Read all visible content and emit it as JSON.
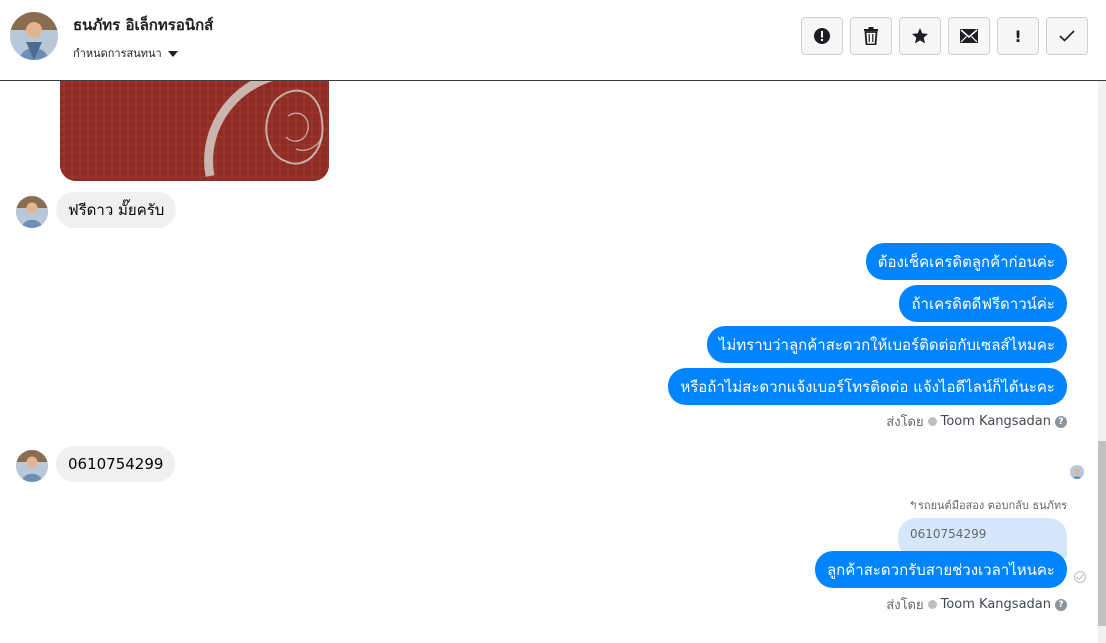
{
  "header": {
    "name": "ธนภัทร อิเล็กทรอนิกส์",
    "subtitle": "กำหนดการสนทนา"
  },
  "actions": [
    {
      "icon": "alert-circle-icon"
    },
    {
      "icon": "trash-icon"
    },
    {
      "icon": "star-icon"
    },
    {
      "icon": "mail-icon"
    },
    {
      "icon": "exclamation-icon",
      "label": "!"
    },
    {
      "icon": "check-icon"
    }
  ],
  "messages": {
    "incoming_1": "ฟรีดาว มั๊ยครับ",
    "outgoing_1": "ต้องเช็คเครดิตลูกค้าก่อนค่ะ",
    "outgoing_2": "ถ้าเครดิตดีฟรีดาวน์ค่ะ",
    "outgoing_3": "ไม่ทราบว่าลูกค้าสะดวกให้เบอร์ติดต่อกับเซลส์ไหมคะ",
    "outgoing_4": "หรือถ้าไม่สะดวกแจ้งเบอร์โทรติดต่อ แจ้งไอดีไลน์ก็ได้นะคะ",
    "incoming_2": "0610754299",
    "reply_note": "รถยนต์มือสอง ตอบกลับ ธนภัทร",
    "reply_quote": "0610754299",
    "outgoing_5": "ลูกค้าสะดวกรับสายช่วงเวลาไหนคะ"
  },
  "sent_by": {
    "prefix": "ส่งโดย",
    "name": "Toom Kangsadan",
    "help": "?"
  },
  "colors": {
    "outgoing_bubble": "#0084ff",
    "incoming_bubble": "#f0f0f0",
    "reply_quote_bg": "#d7e7fb"
  }
}
